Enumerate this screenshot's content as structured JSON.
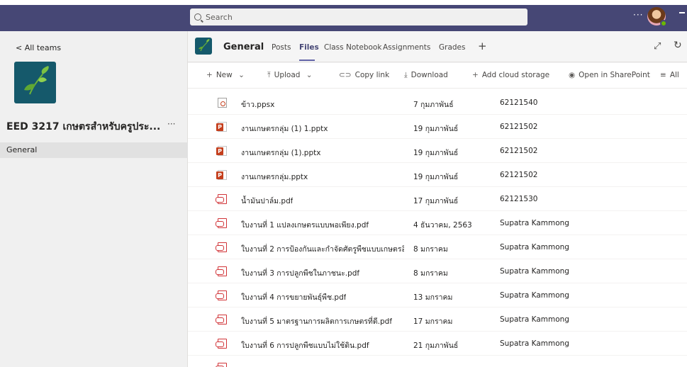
{
  "topbar": {
    "search_placeholder": "Search",
    "more_label": "···"
  },
  "sidebar": {
    "back_label": "< All teams",
    "team_name": "EED 3217 เกษตรสำหรับครูประ...",
    "team_more": "···",
    "channels": [
      {
        "label": "General"
      }
    ]
  },
  "header": {
    "channel_title": "General",
    "tabs": [
      {
        "label": "Posts"
      },
      {
        "label": "Files"
      },
      {
        "label": "Class Notebook"
      },
      {
        "label": "Assignments"
      },
      {
        "label": "Grades"
      }
    ],
    "add_tab": "+"
  },
  "commands": {
    "new": "New",
    "upload": "Upload",
    "copy_link": "Copy link",
    "download": "Download",
    "add_cloud": "Add cloud storage",
    "open_sharepoint": "Open in SharePoint",
    "all": "All"
  },
  "files": [
    {
      "name": "ข้าว.ppsx",
      "type": "ppsx",
      "modified": "7 กุมภาพันธ์",
      "by": "62121540"
    },
    {
      "name": "งานเกษตรกลุ่ม (1) 1.pptx",
      "type": "pptx",
      "modified": "19 กุมภาพันธ์",
      "by": "62121502"
    },
    {
      "name": "งานเกษตรกลุ่ม (1).pptx",
      "type": "pptx",
      "modified": "19 กุมภาพันธ์",
      "by": "62121502"
    },
    {
      "name": "งานเกษตรกลุ่ม.pptx",
      "type": "pptx",
      "modified": "19 กุมภาพันธ์",
      "by": "62121502"
    },
    {
      "name": "น้ำมันปาล์ม.pdf",
      "type": "pdf",
      "modified": "17 กุมภาพันธ์",
      "by": "62121530"
    },
    {
      "name": "ใบงานที่ 1 แปลงเกษตรแบบพอเพียง.pdf",
      "type": "pdf",
      "modified": "4 ธันวาคม, 2563",
      "by": "Supatra Kammong"
    },
    {
      "name": "ใบงานที่ 2 การป้องกันและกำจัดศัตรูพืชแบบเกษตรอิ...",
      "type": "pdf",
      "modified": "8 มกราคม",
      "by": "Supatra Kammong"
    },
    {
      "name": "ใบงานที่ 3 การปลูกพืชในภาชนะ.pdf",
      "type": "pdf",
      "modified": "8 มกราคม",
      "by": "Supatra Kammong"
    },
    {
      "name": "ใบงานที่ 4 การขยายพันธุ์พืช.pdf",
      "type": "pdf",
      "modified": "13 มกราคม",
      "by": "Supatra Kammong"
    },
    {
      "name": "ใบงานที่ 5 มาตรฐานการผลิตการเกษตรที่ดี.pdf",
      "type": "pdf",
      "modified": "17 มกราคม",
      "by": "Supatra Kammong"
    },
    {
      "name": "ใบงานที่ 6 การปลูกพืชแบบไม่ใช้ดิน.pdf",
      "type": "pdf",
      "modified": "21 กุมภาพันธ์",
      "by": "Supatra Kammong"
    }
  ]
}
